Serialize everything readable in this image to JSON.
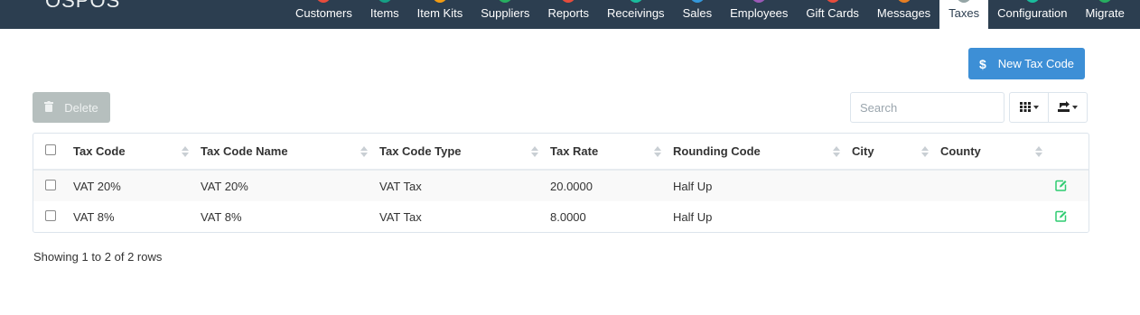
{
  "app": {
    "brand": "OSPOS"
  },
  "nav": {
    "items": [
      {
        "label": "Customers",
        "color": "#e74c3c"
      },
      {
        "label": "Items",
        "color": "#16a085"
      },
      {
        "label": "Item Kits",
        "color": "#f39c12"
      },
      {
        "label": "Suppliers",
        "color": "#27ae60"
      },
      {
        "label": "Reports",
        "color": "#e74c3c"
      },
      {
        "label": "Receivings",
        "color": "#1abc9c"
      },
      {
        "label": "Sales",
        "color": "#3498db"
      },
      {
        "label": "Employees",
        "color": "#9b59b6"
      },
      {
        "label": "Gift Cards",
        "color": "#e74c3c"
      },
      {
        "label": "Messages",
        "color": "#e67e22"
      },
      {
        "label": "Taxes",
        "color": "#95a5a6",
        "active": true
      },
      {
        "label": "Configuration",
        "color": "#1abc9c"
      },
      {
        "label": "Migrate",
        "color": "#27ae60"
      }
    ]
  },
  "toolbar": {
    "new_label": "New Tax Code",
    "new_icon": "dollar-icon",
    "delete_label": "Delete",
    "delete_icon": "trash-icon",
    "search_placeholder": "Search",
    "columns_icon": "grid-icon",
    "export_icon": "export-icon"
  },
  "table": {
    "columns": [
      "Tax Code",
      "Tax Code Name",
      "Tax Code Type",
      "Tax Rate",
      "Rounding Code",
      "City",
      "County"
    ],
    "rows": [
      [
        "VAT 20%",
        "VAT 20%",
        "VAT Tax",
        "20.0000",
        "Half Up",
        "",
        ""
      ],
      [
        "VAT 8%",
        "VAT 8%",
        "VAT Tax",
        "8.0000",
        "Half Up",
        "",
        ""
      ]
    ],
    "edit_icon": "edit-icon",
    "edit_color": "#2ecc71"
  },
  "pagination": {
    "summary": "Showing 1 to 2 of 2 rows"
  },
  "colors": {
    "nav_bg": "#2c3e50",
    "primary": "#3d8fd6",
    "disabled": "#b6bfbe"
  }
}
